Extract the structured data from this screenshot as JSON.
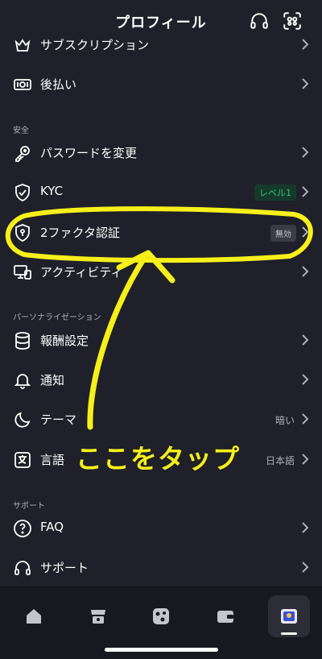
{
  "header": {
    "title": "プロフィール",
    "support_icon": "headset-icon",
    "scan_icon": "qr-scan-icon"
  },
  "rows": {
    "subscription": {
      "label": "サブスクリプション",
      "icon": "crown-icon"
    },
    "deferred": {
      "label": "後払い",
      "icon": "card-icon"
    },
    "password": {
      "label": "パスワードを変更",
      "icon": "key-icon"
    },
    "kyc": {
      "label": "KYC",
      "badge": "レベル1",
      "icon": "shield-check-icon"
    },
    "twofa": {
      "label": "2ファクタ認証",
      "badge": "無効",
      "icon": "shield-key-icon"
    },
    "activity": {
      "label": "アクティビティ",
      "icon": "devices-icon"
    },
    "reward": {
      "label": "報酬設定",
      "icon": "database-icon"
    },
    "notify": {
      "label": "通知",
      "icon": "bell-icon"
    },
    "theme": {
      "label": "テーマ",
      "value": "暗い",
      "icon": "moon-icon"
    },
    "language": {
      "label": "言語",
      "value": "日本語",
      "icon": "language-icon"
    },
    "faq": {
      "label": "FAQ",
      "icon": "question-icon"
    },
    "support": {
      "label": "サポート",
      "icon": "headset-icon"
    }
  },
  "sections": {
    "security": "安全",
    "personalization": "パーソナライゼーション",
    "support": "サポート"
  },
  "annotation": {
    "text": "ここをタップ",
    "color": "#f5f019"
  },
  "tabs": [
    "home-icon",
    "market-icon",
    "trade-icon",
    "wallet-icon",
    "profile-icon"
  ],
  "colors": {
    "background": "#1f2029",
    "accent_green": "#35c07a"
  }
}
